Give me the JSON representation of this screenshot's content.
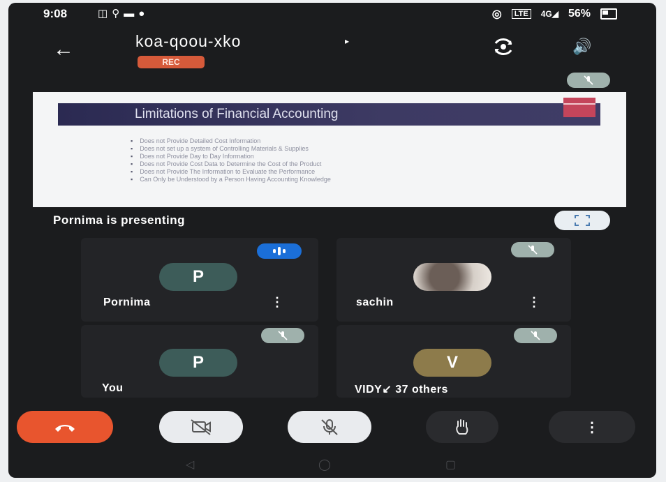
{
  "status_bar": {
    "time": "9:08",
    "battery": "56%",
    "left_icons": [
      "video-notification-icon",
      "search-notification-icon",
      "message-notification-icon",
      "mic-notification-icon"
    ],
    "right_icons": [
      "hotspot-icon",
      "volte-icon",
      "signal-4g-icon",
      "battery-icon"
    ]
  },
  "header": {
    "meeting_code": "koa-qoou-xko",
    "chevron": "▸",
    "rec_label": "REC",
    "icons": [
      "back-arrow-icon",
      "switch-camera-icon",
      "speaker-icon"
    ]
  },
  "presentation": {
    "slide_title": "Limitations of Financial Accounting",
    "bullets": [
      "Does not Provide Detailed Cost Information",
      "Does not set up a system of Controlling Materials & Supplies",
      "Does not Provide Day to Day Information",
      "Does not Provide Cost Data to Determine the Cost of the Product",
      "Does not Provide The Information to Evaluate the Performance",
      "Can Only be Understood by a Person Having Accounting Knowledge"
    ],
    "presenting_text": "Pornima is presenting"
  },
  "participants": [
    {
      "name": "Pornima",
      "initial": "P",
      "avatar_color": "#3d5c59",
      "status": "speaking"
    },
    {
      "name": "sachin",
      "initial": "",
      "avatar_color": "#cfc8c2",
      "status": "muted"
    },
    {
      "name": "You",
      "initial": "P",
      "avatar_color": "#3d5c59",
      "status": "muted"
    },
    {
      "name": "VIDYA",
      "initial": "V",
      "avatar_color": "#8d7b4b",
      "status": "muted"
    }
  ],
  "others_text": "VIDY↙ 37 others",
  "controls": {
    "end_call_color": "#e8552e",
    "items": [
      "end-call-icon",
      "camera-off-icon",
      "mic-off-icon",
      "raise-hand-icon",
      "more-icon"
    ]
  },
  "colors": {
    "background": "#1b1c1e",
    "tile": "#232427",
    "rec_badge": "#d65a3a",
    "speaking_badge": "#1b6fd8",
    "muted_badge": "#9fb1ac"
  }
}
